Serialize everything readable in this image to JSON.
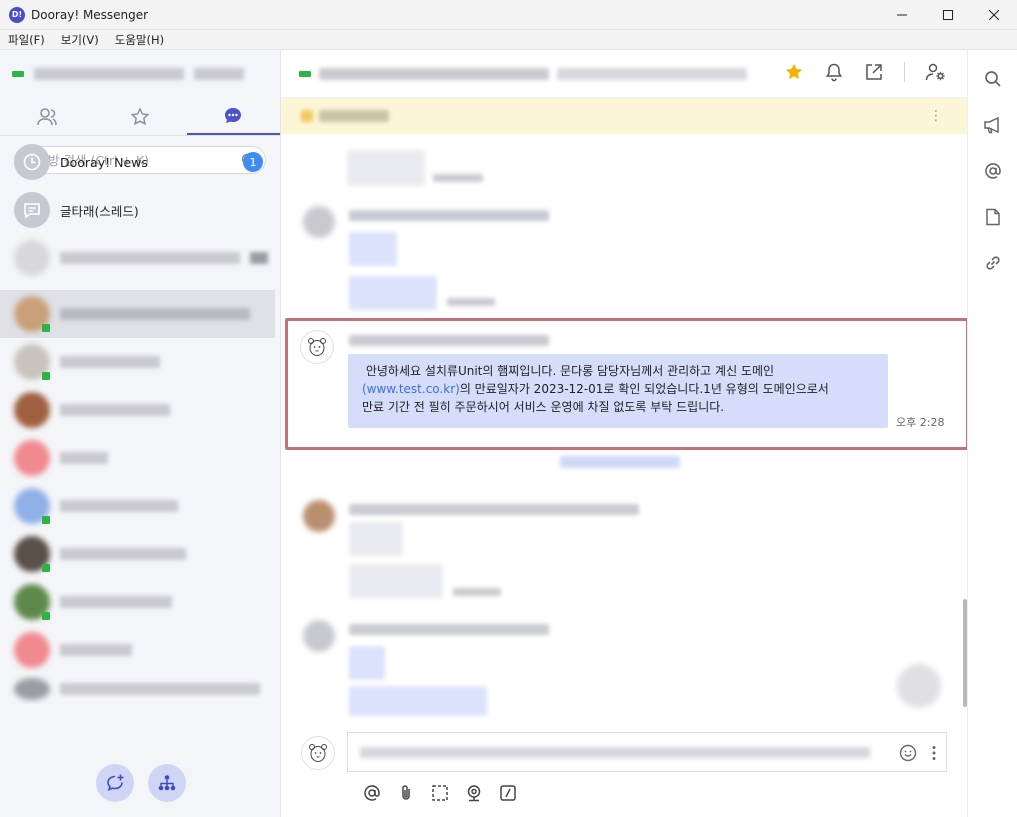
{
  "window": {
    "title": "Dooray! Messenger",
    "logo_text": "D!"
  },
  "menu": [
    "파일(F)",
    "보기(V)",
    "도움말(H)"
  ],
  "sidebar": {
    "search_placeholder": "대화방 검색 (Ctrl + K)",
    "conversations": [
      {
        "name": "Dooray! News",
        "badge": "1",
        "icon": "clock-icon"
      },
      {
        "name": "글타래(스레드)",
        "icon": "thread-icon"
      }
    ]
  },
  "message": {
    "line1": "안녕하세요 설치류Unit의 햄찌입니다. 문다롱 담당자님께서 관리하고 계신 도메인",
    "link": "(www.test.co.kr)",
    "line2_rest": "의 만료일자가 2023-12-01로 확인 되었습니다.1년 유형의 도메인으로서",
    "line3": "만료 기간 전 필히 주문하시어 서비스 운영에 차질 없도록 부탁 드립니다.",
    "time": "오후 2:28"
  },
  "colors": {
    "accent": "#4a54c8",
    "bubble": "#d5ddfb",
    "highlight_border": "#c8707a",
    "badge": "#3d8ef0",
    "online": "#2fb344",
    "star": "#f5b301"
  }
}
